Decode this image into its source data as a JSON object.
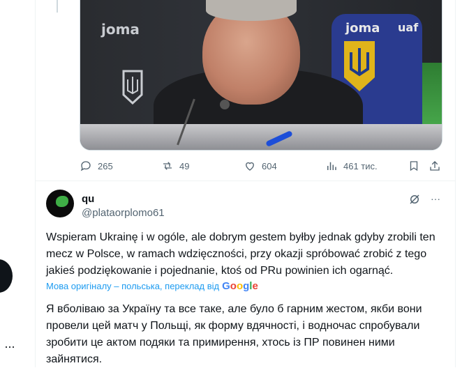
{
  "post_above": {
    "image_alt": "man smiling at press conference",
    "image_texts": {
      "brand_left": "joma",
      "brand_mid": "joma",
      "brand_right": "uaf"
    },
    "stats": {
      "replies": "265",
      "reposts": "49",
      "likes": "604",
      "views": "461 тис."
    }
  },
  "post": {
    "display_name": "qu",
    "handle": "@plataorplomo61",
    "text": "Wspieram Ukrainę i w ogóle, ale dobrym gestem byłby jednak gdyby zrobili ten mecz w Polsce, w ramach wdzięczności, przy okazji spróbować zrobić z tego jakieś podziękowanie i pojednanie, ktoś od PRu powinien ich ogarnąć.",
    "translated_by": "Мова оригіналу – польська, переклад від",
    "translator": "Google",
    "translation": "Я вболіваю за Україну та все таке, але було б гарним жестом, якби вони провели цей матч у Польщі, як форму вдячності, і водночас спробували зробити це актом подяки та примирення, хтось із ПР повинен ними зайнятися.",
    "more_label": "···"
  },
  "left_rail": {
    "more_label": "···"
  },
  "colors": {
    "link": "#1d9bf0",
    "muted": "#536471",
    "text": "#0f1419"
  }
}
